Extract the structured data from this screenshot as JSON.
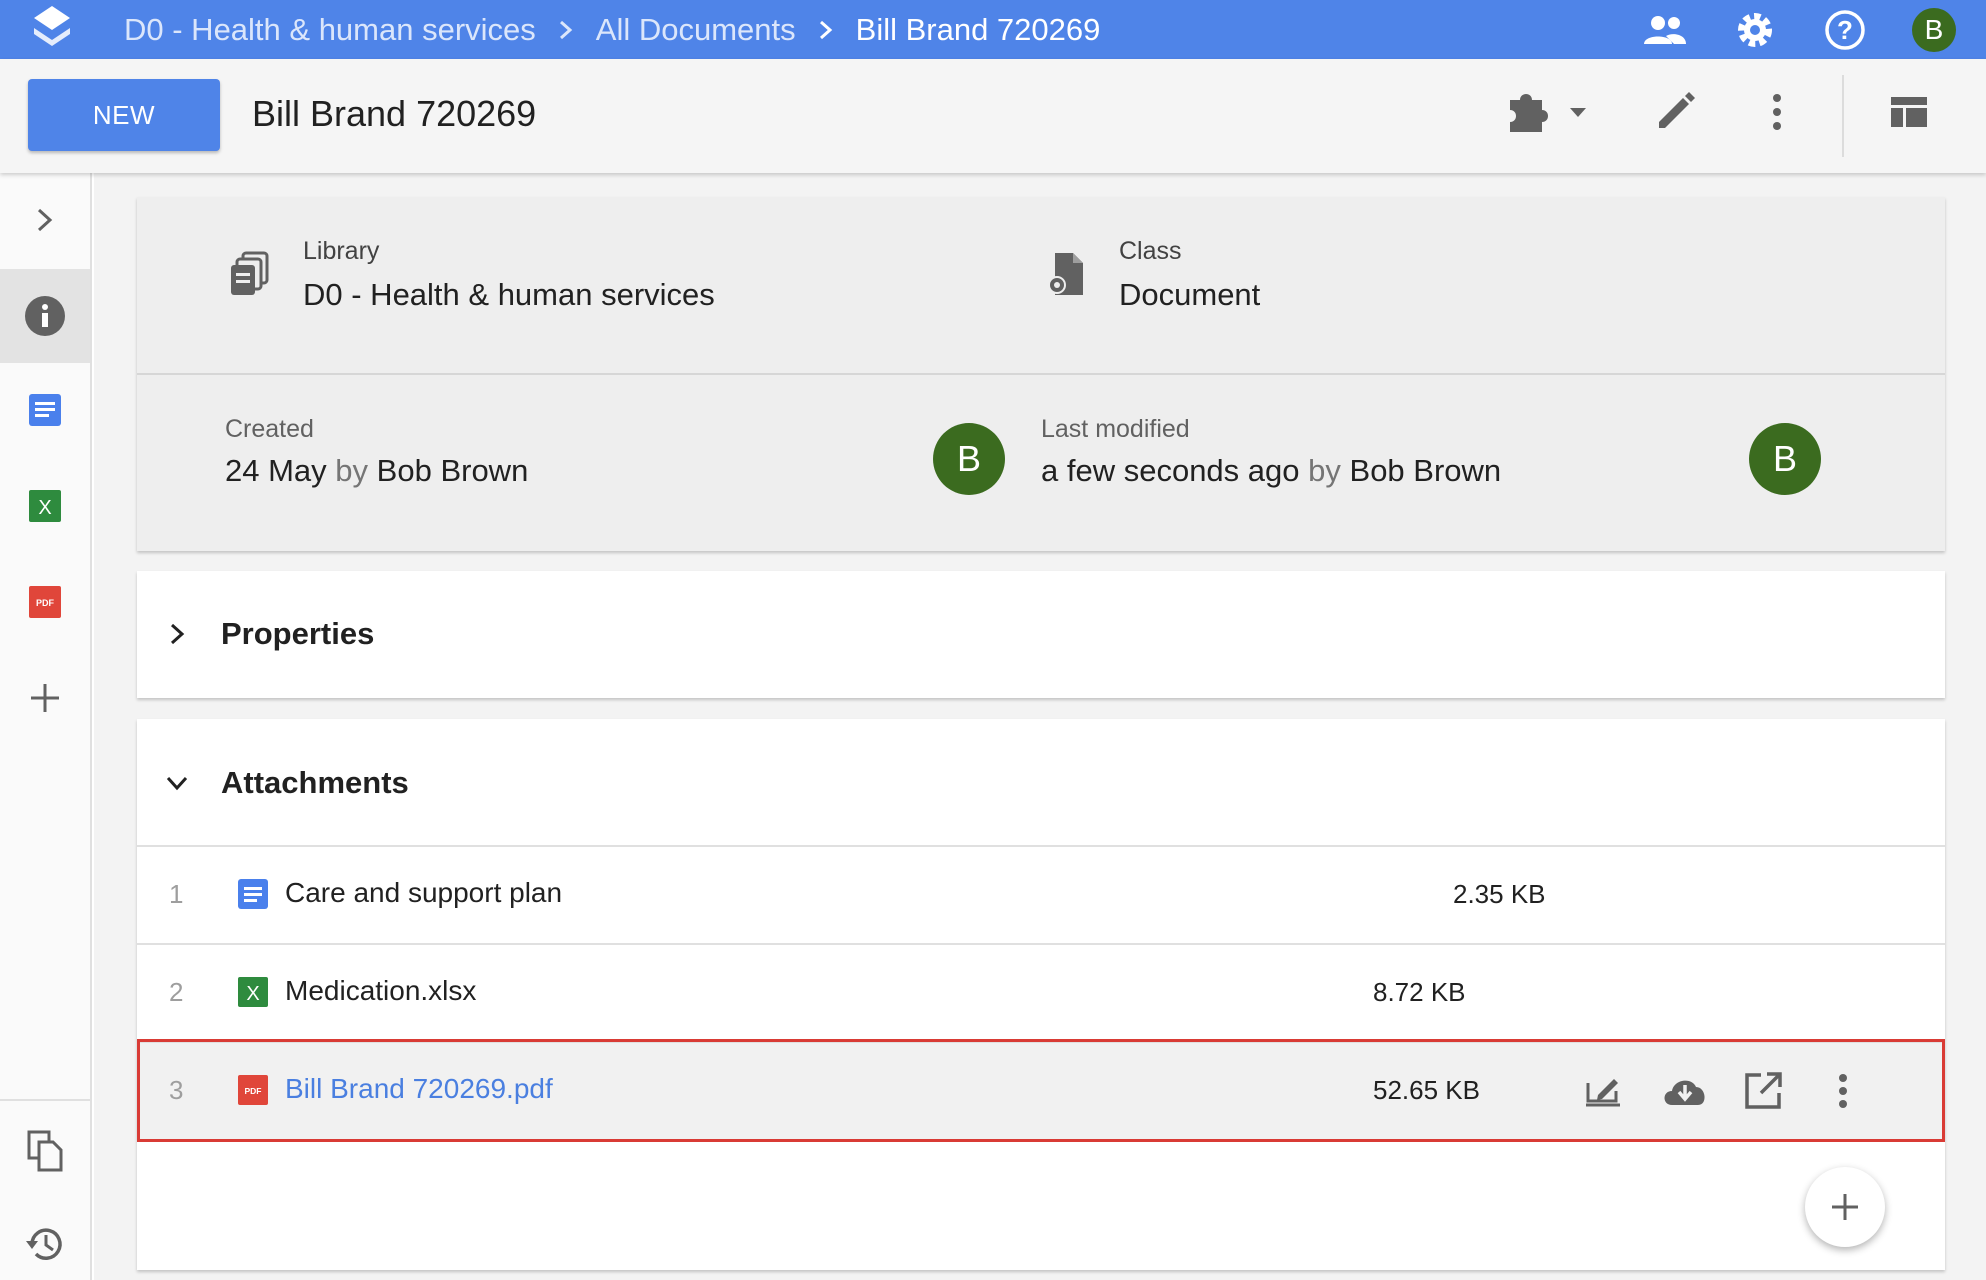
{
  "breadcrumb": {
    "items": [
      "D0 - Health & human services",
      "All Documents"
    ],
    "current": "Bill Brand 720269"
  },
  "topbar": {
    "user_initial": "B",
    "icons": [
      "people-icon",
      "gear-icon",
      "help-icon"
    ]
  },
  "toolbar": {
    "new_label": "NEW",
    "title": "Bill Brand 720269"
  },
  "info": {
    "library_label": "Library",
    "library_value": "D0 - Health & human services",
    "class_label": "Class",
    "class_value": "Document",
    "created_label": "Created",
    "created_date": "24 May",
    "created_by_word": "by",
    "created_by": "Bob Brown",
    "created_initial": "B",
    "modified_label": "Last modified",
    "modified_date": "a few seconds ago",
    "modified_by_word": "by",
    "modified_by": "Bob Brown",
    "modified_initial": "B"
  },
  "properties": {
    "title": "Properties"
  },
  "attachments": {
    "title": "Attachments",
    "rows": [
      {
        "num": "1",
        "name": "Care and support plan",
        "size": "2.35 KB",
        "type": "doc"
      },
      {
        "num": "2",
        "name": "Medication.xlsx",
        "size": "8.72 KB",
        "type": "xlsx"
      },
      {
        "num": "3",
        "name": "Bill Brand 720269.pdf",
        "size": "52.65 KB",
        "type": "pdf"
      }
    ]
  },
  "sidebar": {
    "icons": [
      "expand-icon",
      "info-icon",
      "doc-icon",
      "excel-icon",
      "pdf-icon",
      "add-icon",
      "copy-icon",
      "history-icon"
    ]
  },
  "colors": {
    "accent": "#4f84e8",
    "avatar": "#3b6b1f",
    "selection_outline": "#d93b35",
    "link": "#4a7fe0"
  }
}
